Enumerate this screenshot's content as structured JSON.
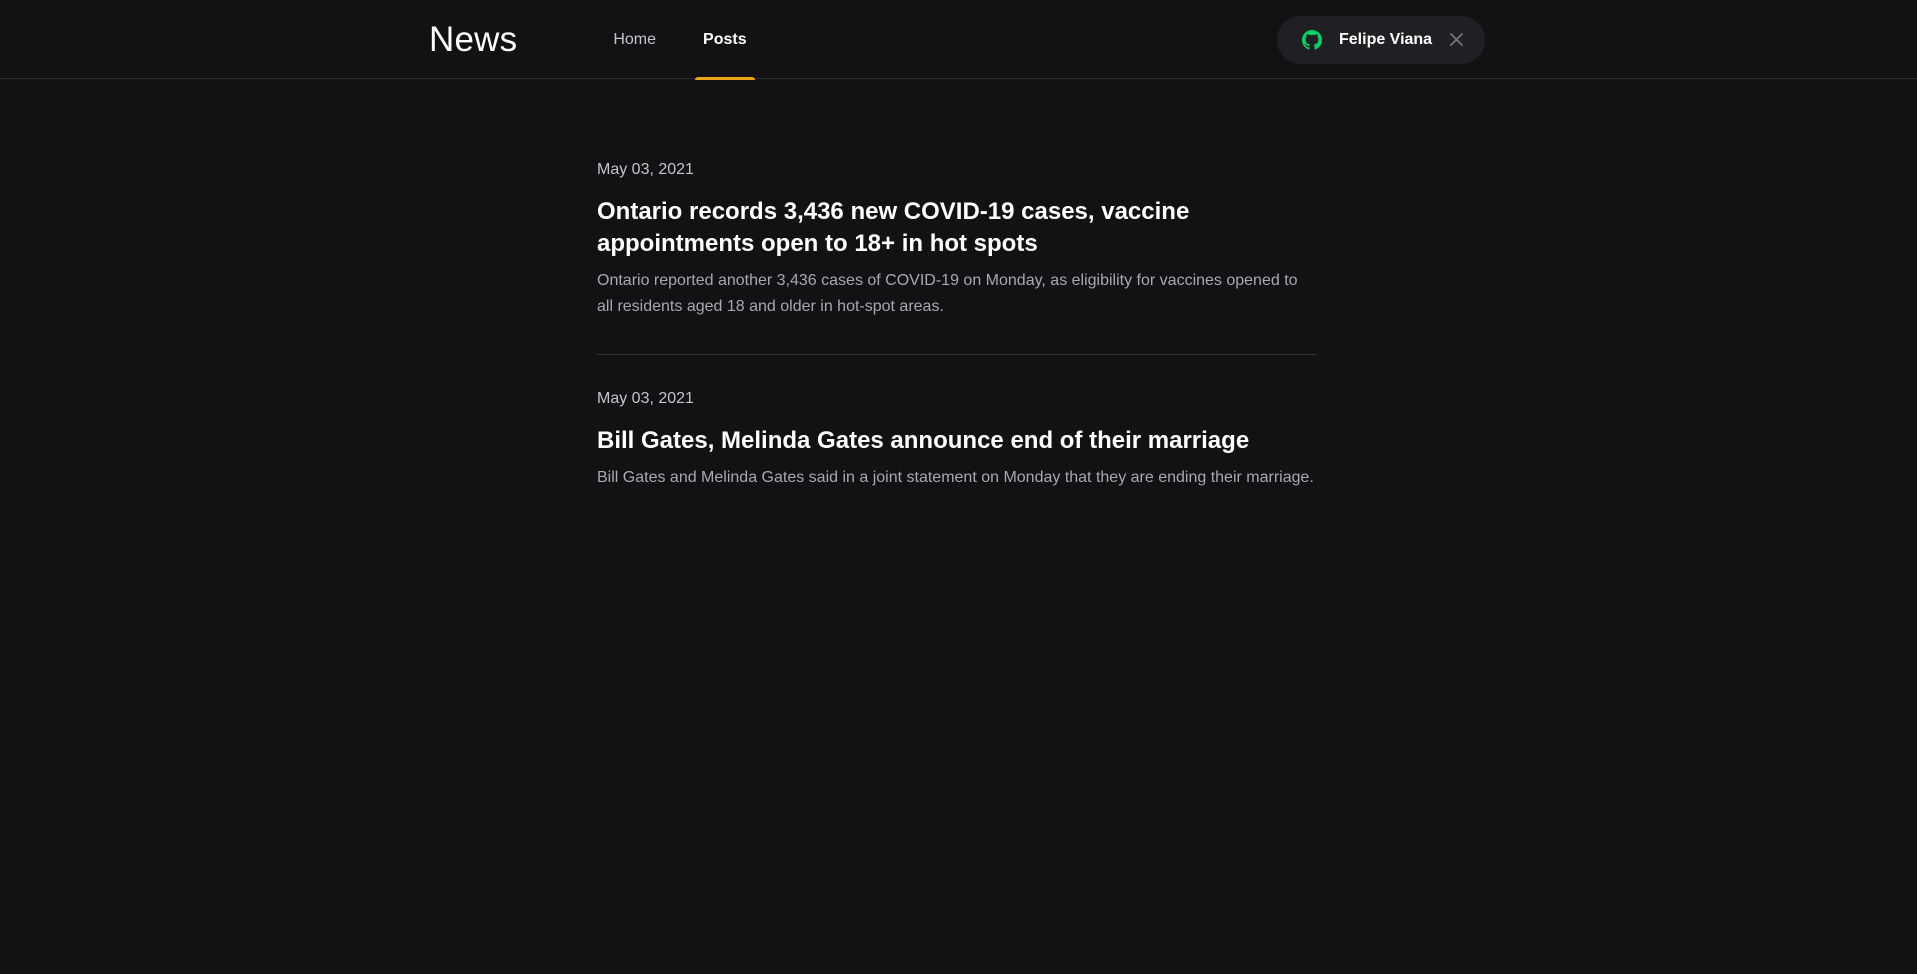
{
  "header": {
    "logo": "News",
    "nav": [
      {
        "label": "Home",
        "active": false
      },
      {
        "label": "Posts",
        "active": true
      }
    ],
    "user": {
      "name": "Felipe Viana",
      "icon": "github-icon",
      "icon_color": "#04d361",
      "close_icon": "close-icon"
    }
  },
  "colors": {
    "background": "#121214",
    "accent": "#eba417",
    "divider": "#323238"
  },
  "posts": [
    {
      "date": "May 03, 2021",
      "title": "Ontario records 3,436 new COVID-19 cases, vaccine appointments open to 18+ in hot spots",
      "excerpt": "Ontario reported another 3,436 cases of COVID-19 on Monday, as eligibility for vaccines opened to all residents aged 18 and older in hot-spot areas."
    },
    {
      "date": "May 03, 2021",
      "title": "Bill Gates, Melinda Gates announce end of their marriage",
      "excerpt": "Bill Gates and Melinda Gates said in a joint statement on Monday that they are ending their marriage."
    }
  ]
}
